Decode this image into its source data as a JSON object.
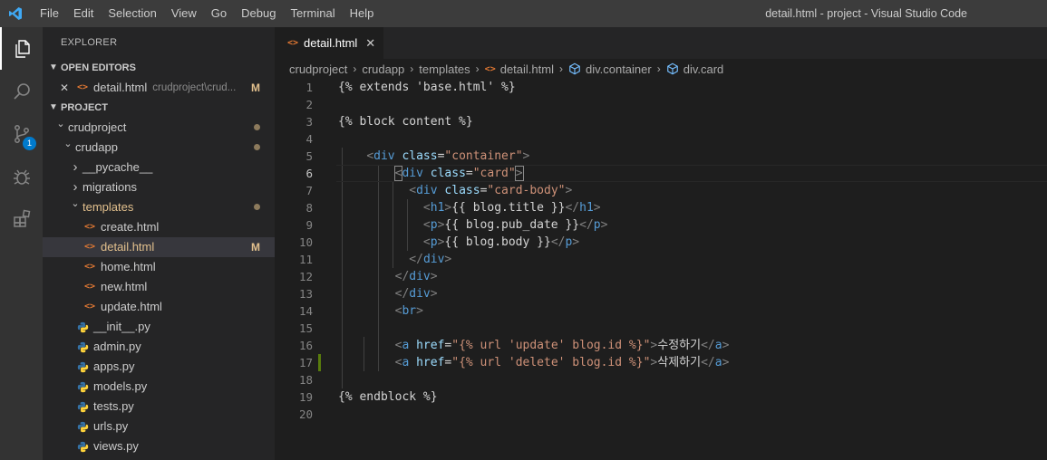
{
  "titlebar": {
    "menu": [
      "File",
      "Edit",
      "Selection",
      "View",
      "Go",
      "Debug",
      "Terminal",
      "Help"
    ],
    "window_title": "detail.html - project - Visual Studio Code"
  },
  "activitybar": {
    "items": [
      "explorer-icon",
      "search-icon",
      "source-control-icon",
      "debug-icon",
      "extensions-icon"
    ],
    "scm_badge": "1"
  },
  "sidebar": {
    "title": "EXPLORER",
    "open_editors_label": "OPEN EDITORS",
    "open_editor": {
      "name": "detail.html",
      "path": "crudproject\\crud...",
      "status": "M"
    },
    "project_label": "PROJECT",
    "tree": [
      {
        "name": "crudproject",
        "indent": 1,
        "type": "folder-open",
        "dot": true
      },
      {
        "name": "crudapp",
        "indent": 2,
        "type": "folder-open",
        "dot": true
      },
      {
        "name": "__pycache__",
        "indent": 3,
        "type": "folder-closed"
      },
      {
        "name": "migrations",
        "indent": 3,
        "type": "folder-closed"
      },
      {
        "name": "templates",
        "indent": 3,
        "type": "folder-open",
        "dot": true,
        "modified": true
      },
      {
        "name": "create.html",
        "indent": 4,
        "type": "html"
      },
      {
        "name": "detail.html",
        "indent": 4,
        "type": "html",
        "modified": true,
        "status": "M",
        "selected": true
      },
      {
        "name": "home.html",
        "indent": 4,
        "type": "html"
      },
      {
        "name": "new.html",
        "indent": 4,
        "type": "html"
      },
      {
        "name": "update.html",
        "indent": 4,
        "type": "html"
      },
      {
        "name": "__init__.py",
        "indent": 3,
        "type": "py"
      },
      {
        "name": "admin.py",
        "indent": 3,
        "type": "py"
      },
      {
        "name": "apps.py",
        "indent": 3,
        "type": "py"
      },
      {
        "name": "models.py",
        "indent": 3,
        "type": "py"
      },
      {
        "name": "tests.py",
        "indent": 3,
        "type": "py"
      },
      {
        "name": "urls.py",
        "indent": 3,
        "type": "py"
      },
      {
        "name": "views.py",
        "indent": 3,
        "type": "py"
      }
    ]
  },
  "tab": {
    "label": "detail.html"
  },
  "breadcrumbs": [
    "crudproject",
    "crudapp",
    "templates",
    "detail.html",
    "div.container",
    "div.card"
  ],
  "editor": {
    "lines": [
      {
        "n": "1",
        "tokens": [
          [
            "plain",
            "{% extends 'base.html' %}"
          ]
        ]
      },
      {
        "n": "2",
        "tokens": []
      },
      {
        "n": "3",
        "tokens": [
          [
            "plain",
            "{% block content %}"
          ]
        ]
      },
      {
        "n": "4",
        "tokens": []
      },
      {
        "n": "5",
        "tokens": [
          [
            "plain",
            "    "
          ],
          [
            "bracket",
            "<"
          ],
          [
            "tag",
            "div"
          ],
          [
            "plain",
            " "
          ],
          [
            "attr",
            "class"
          ],
          [
            "eq",
            "="
          ],
          [
            "str",
            "\"container\""
          ],
          [
            "bracket",
            ">"
          ]
        ]
      },
      {
        "n": "6",
        "tokens": [
          [
            "plain",
            "        "
          ],
          [
            "bracket-hl",
            "<"
          ],
          [
            "tag",
            "div"
          ],
          [
            "plain",
            " "
          ],
          [
            "attr",
            "class"
          ],
          [
            "eq",
            "="
          ],
          [
            "str",
            "\"card\""
          ],
          [
            "bracket-hl",
            ">"
          ]
        ],
        "current": true
      },
      {
        "n": "7",
        "tokens": [
          [
            "plain",
            "          "
          ],
          [
            "bracket",
            "<"
          ],
          [
            "tag",
            "div"
          ],
          [
            "plain",
            " "
          ],
          [
            "attr",
            "class"
          ],
          [
            "eq",
            "="
          ],
          [
            "str",
            "\"card-body\""
          ],
          [
            "bracket",
            ">"
          ]
        ]
      },
      {
        "n": "8",
        "tokens": [
          [
            "plain",
            "            "
          ],
          [
            "bracket",
            "<"
          ],
          [
            "tag",
            "h1"
          ],
          [
            "bracket",
            ">"
          ],
          [
            "plain",
            "{{ blog.title }}"
          ],
          [
            "bracket",
            "</"
          ],
          [
            "tag",
            "h1"
          ],
          [
            "bracket",
            ">"
          ]
        ]
      },
      {
        "n": "9",
        "tokens": [
          [
            "plain",
            "            "
          ],
          [
            "bracket",
            "<"
          ],
          [
            "tag",
            "p"
          ],
          [
            "bracket",
            ">"
          ],
          [
            "plain",
            "{{ blog.pub_date }}"
          ],
          [
            "bracket",
            "</"
          ],
          [
            "tag",
            "p"
          ],
          [
            "bracket",
            ">"
          ]
        ]
      },
      {
        "n": "10",
        "tokens": [
          [
            "plain",
            "            "
          ],
          [
            "bracket",
            "<"
          ],
          [
            "tag",
            "p"
          ],
          [
            "bracket",
            ">"
          ],
          [
            "plain",
            "{{ blog.body }}"
          ],
          [
            "bracket",
            "</"
          ],
          [
            "tag",
            "p"
          ],
          [
            "bracket",
            ">"
          ]
        ]
      },
      {
        "n": "11",
        "tokens": [
          [
            "plain",
            "          "
          ],
          [
            "bracket",
            "</"
          ],
          [
            "tag",
            "div"
          ],
          [
            "bracket",
            ">"
          ]
        ]
      },
      {
        "n": "12",
        "tokens": [
          [
            "plain",
            "        "
          ],
          [
            "bracket",
            "</"
          ],
          [
            "tag",
            "div"
          ],
          [
            "bracket",
            ">"
          ]
        ]
      },
      {
        "n": "13",
        "tokens": [
          [
            "plain",
            "        "
          ],
          [
            "bracket",
            "</"
          ],
          [
            "tag",
            "div"
          ],
          [
            "bracket",
            ">"
          ]
        ]
      },
      {
        "n": "14",
        "tokens": [
          [
            "plain",
            "        "
          ],
          [
            "bracket",
            "<"
          ],
          [
            "tag",
            "br"
          ],
          [
            "bracket",
            ">"
          ]
        ]
      },
      {
        "n": "15",
        "tokens": []
      },
      {
        "n": "16",
        "tokens": [
          [
            "plain",
            "        "
          ],
          [
            "bracket",
            "<"
          ],
          [
            "tag",
            "a"
          ],
          [
            "plain",
            " "
          ],
          [
            "attr",
            "href"
          ],
          [
            "eq",
            "="
          ],
          [
            "str",
            "\"{% url 'update' blog.id %}\""
          ],
          [
            "bracket",
            ">"
          ],
          [
            "plain",
            "수정하기"
          ],
          [
            "bracket",
            "</"
          ],
          [
            "tag",
            "a"
          ],
          [
            "bracket",
            ">"
          ]
        ]
      },
      {
        "n": "17",
        "tokens": [
          [
            "plain",
            "        "
          ],
          [
            "bracket",
            "<"
          ],
          [
            "tag",
            "a"
          ],
          [
            "plain",
            " "
          ],
          [
            "attr",
            "href"
          ],
          [
            "eq",
            "="
          ],
          [
            "str",
            "\"{% url 'delete' blog.id %}\""
          ],
          [
            "bracket",
            ">"
          ],
          [
            "plain",
            "삭제하기"
          ],
          [
            "bracket",
            "</"
          ],
          [
            "tag",
            "a"
          ],
          [
            "bracket",
            ">"
          ]
        ],
        "git_added": true
      },
      {
        "n": "18",
        "tokens": []
      },
      {
        "n": "19",
        "tokens": [
          [
            "plain",
            "{% endblock %}"
          ]
        ]
      },
      {
        "n": "20",
        "tokens": []
      }
    ]
  },
  "colors": {
    "accent": "#007acc",
    "modified": "#e2c08d",
    "git_added": "#587c0c"
  }
}
